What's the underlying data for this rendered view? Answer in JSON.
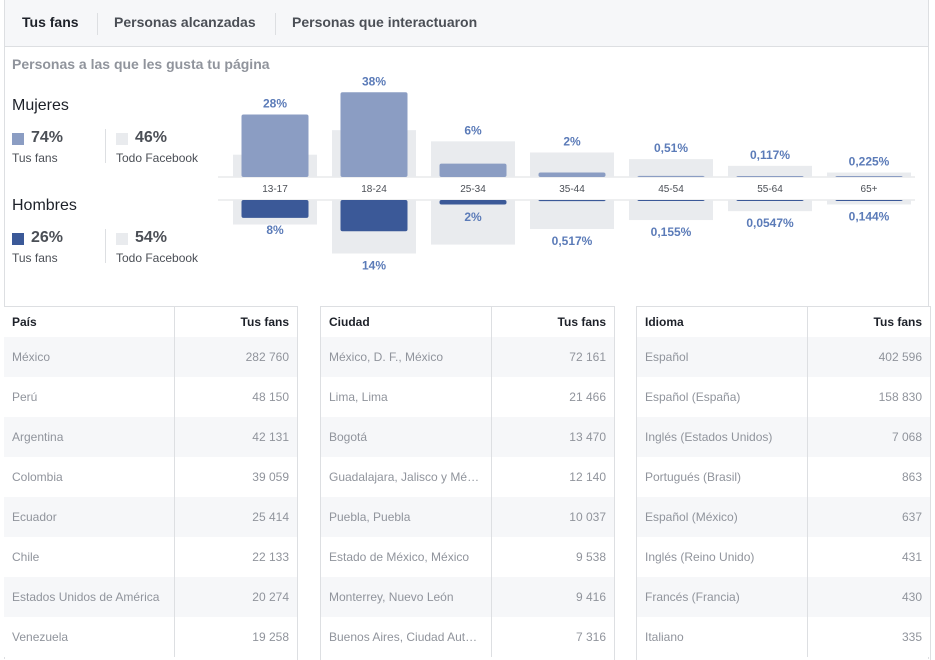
{
  "tabs": [
    {
      "label": "Tus fans"
    },
    {
      "label": "Personas alcanzadas"
    },
    {
      "label": "Personas que interactuaron"
    }
  ],
  "section_title": "Personas a las que les gusta tu página",
  "women": {
    "label": "Mujeres",
    "fans_pct": "74%",
    "fans_label": "Tus fans",
    "facebook_pct": "46%",
    "facebook_label": "Todo Facebook"
  },
  "men": {
    "label": "Hombres",
    "fans_pct": "26%",
    "fans_label": "Tus fans",
    "facebook_pct": "54%",
    "facebook_label": "Todo Facebook"
  },
  "colors": {
    "women_bar": "#8b9dc3",
    "men_bar": "#3b5998",
    "facebook_bar": "#e9ebee",
    "label": "#5b7bb8"
  },
  "chart_data": {
    "type": "bar",
    "categories": [
      "13-17",
      "18-24",
      "25-34",
      "35-44",
      "45-54",
      "55-64",
      "65+"
    ],
    "series": [
      {
        "name": "Mujeres",
        "values": [
          28,
          38,
          6,
          2,
          0.51,
          0.117,
          0.225
        ],
        "labels": [
          "28%",
          "38%",
          "6%",
          "2%",
          "0,51%",
          "0,117%",
          "0,225%"
        ]
      },
      {
        "name": "Hombres",
        "values": [
          8,
          14,
          2,
          0.517,
          0.155,
          0.0547,
          0.144
        ],
        "labels": [
          "8%",
          "14%",
          "2%",
          "0,517%",
          "0,155%",
          "0,0547%",
          "0,144%"
        ]
      }
    ],
    "facebook_women": [
      10,
      21,
      16,
      11,
      8,
      5,
      2
    ],
    "facebook_men": [
      11,
      24,
      20,
      13,
      9,
      5,
      2
    ]
  },
  "tables": [
    {
      "headers": [
        "País",
        "Tus fans"
      ],
      "rows": [
        [
          "México",
          "282 760"
        ],
        [
          "Perú",
          "48 150"
        ],
        [
          "Argentina",
          "42 131"
        ],
        [
          "Colombia",
          "39 059"
        ],
        [
          "Ecuador",
          "25 414"
        ],
        [
          "Chile",
          "22 133"
        ],
        [
          "Estados Unidos de América",
          "20 274"
        ],
        [
          "Venezuela",
          "19 258"
        ]
      ]
    },
    {
      "headers": [
        "Ciudad",
        "Tus fans"
      ],
      "rows": [
        [
          "México, D. F., México",
          "72 161"
        ],
        [
          "Lima, Lima",
          "21 466"
        ],
        [
          "Bogotá",
          "13 470"
        ],
        [
          "Guadalajara, Jalisco y Mé…",
          "12 140"
        ],
        [
          "Puebla, Puebla",
          "10 037"
        ],
        [
          "Estado de México, México",
          "9 538"
        ],
        [
          "Monterrey, Nuevo León",
          "9 416"
        ],
        [
          "Buenos Aires, Ciudad Aut…",
          "7 316"
        ]
      ]
    },
    {
      "headers": [
        "Idioma",
        "Tus fans"
      ],
      "rows": [
        [
          "Español",
          "402 596"
        ],
        [
          "Español (España)",
          "158 830"
        ],
        [
          "Inglés (Estados Unidos)",
          "7 068"
        ],
        [
          "Portugués (Brasil)",
          "863"
        ],
        [
          "Español (México)",
          "637"
        ],
        [
          "Inglés (Reino Unido)",
          "431"
        ],
        [
          "Francés (Francia)",
          "430"
        ],
        [
          "Italiano",
          "335"
        ]
      ]
    }
  ]
}
